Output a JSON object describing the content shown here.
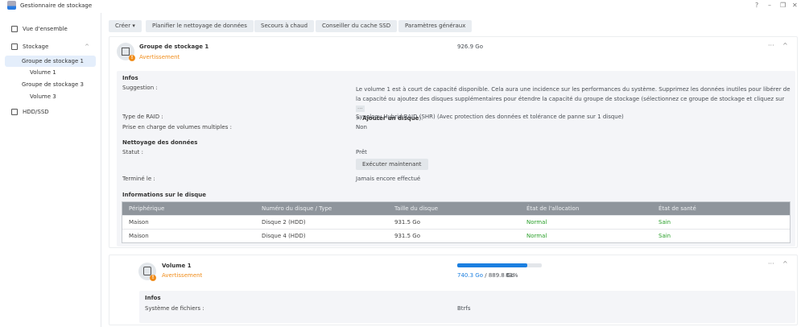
{
  "app": {
    "title": "Gestionnaire de stockage",
    "window_controls": [
      "?",
      "–",
      "❐",
      "✕"
    ]
  },
  "sidebar": {
    "items": [
      {
        "label": "Vue d'ensemble"
      },
      {
        "label": "Stockage"
      },
      {
        "label": "Groupe de stockage 1"
      },
      {
        "label": "Volume 1"
      },
      {
        "label": "Groupe de stockage 3"
      },
      {
        "label": "Volume 3"
      },
      {
        "label": "HDD/SSD"
      }
    ]
  },
  "toolbar": {
    "create": "Créer ▾",
    "schedule": "Planifier le nettoyage de données",
    "hotspare": "Secours à chaud",
    "ssd": "Conseiller du cache SSD",
    "settings": "Paramètres généraux"
  },
  "pool": {
    "name": "Groupe de stockage 1",
    "status": "Avertissement",
    "size": "926.9 Go",
    "more": "···",
    "collapse": "^",
    "infos_title": "Infos",
    "suggestion_label": "Suggestion :",
    "suggestion_text": "Le volume 1 est à court de capacité disponible. Cela aura une incidence sur les performances du système. Supprimez les données inutiles pour libérer de la capacité ou ajoutez des disques supplémentaires pour étendre la capacité du groupe de stockage (sélectionnez ce groupe de stockage et cliquez sur",
    "suggestion_dots": "···",
    "suggestion_gt": ">",
    "suggestion_bold": "Ajouter un disque",
    "suggestion_end": ").",
    "raid_label": "Type de RAID :",
    "raid_value": "Synology Hybrid RAID (SHR) (Avec protection des données et tolérance de panne sur 1 disque)",
    "multi_label": "Prise en charge de volumes multiples :",
    "multi_value": "Non",
    "scrub_title": "Nettoyage des données",
    "status_label": "Statut :",
    "status_value": "Prêt",
    "run_now": "Exécuter maintenant",
    "done_label": "Terminé le :",
    "done_value": "Jamais encore effectué",
    "disk_title": "Informations sur le disque",
    "table": {
      "headers": [
        "Périphérique",
        "Numéro du disque / Type",
        "Taille du disque",
        "État de l'allocation",
        "État de santé"
      ],
      "rows": [
        [
          "Maison",
          "Disque 2 (HDD)",
          "931.5 Go",
          "Normal",
          "Sain"
        ],
        [
          "Maison",
          "Disque 4 (HDD)",
          "931.5 Go",
          "Normal",
          "Sain"
        ]
      ]
    }
  },
  "volume": {
    "name": "Volume 1",
    "status": "Avertissement",
    "used": "740.3 Go",
    "sep": "/",
    "total": "889.8 Go",
    "percent": "83%",
    "usage_fraction": 0.83,
    "more": "···",
    "collapse": "^",
    "infos_title": "Infos",
    "fs_label": "Système de fichiers :",
    "fs_value": "Btrfs"
  },
  "colors": {
    "accent": "#1b7fe0",
    "warning": "#f08c1a",
    "ok": "#2aa02a"
  }
}
